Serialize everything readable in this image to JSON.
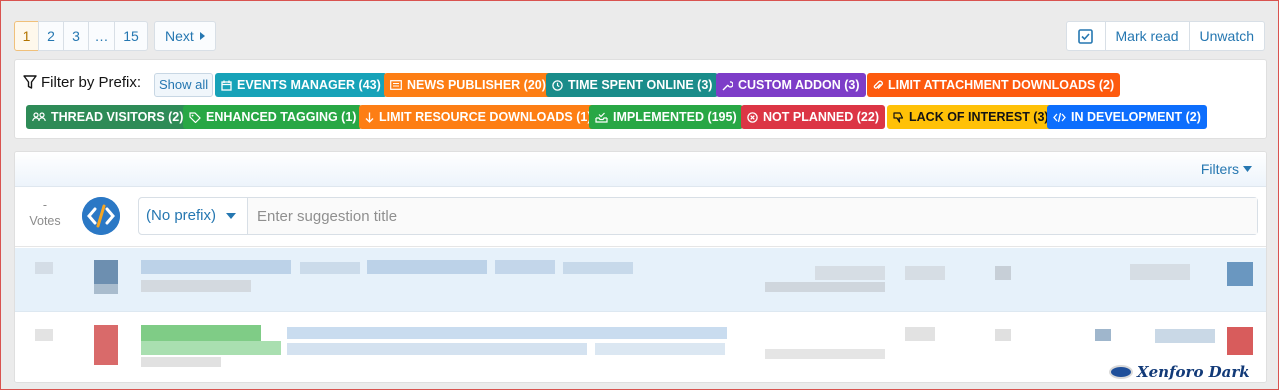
{
  "pagination": {
    "pages": [
      "1",
      "2",
      "3",
      "…",
      "15"
    ],
    "current": "1",
    "next_label": "Next"
  },
  "toolbar": {
    "mark_read": "Mark read",
    "unwatch": "Unwatch"
  },
  "filter": {
    "label": "Filter by Prefix:",
    "show_all": "Show all",
    "prefixes": [
      {
        "label": "EVENTS MANAGER (43)",
        "color": "#17a2b8",
        "icon": "calendar-icon"
      },
      {
        "label": "NEWS PUBLISHER (20)",
        "color": "#fd7e14",
        "icon": "newspaper-icon"
      },
      {
        "label": "TIME SPENT ONLINE (3)",
        "color": "#1a8c8a",
        "icon": "clock-icon"
      },
      {
        "label": "CUSTOM ADDON (3)",
        "color": "#7d3dc8",
        "icon": "wrench-icon"
      },
      {
        "label": "LIMIT ATTACHMENT DOWNLOADS (2)",
        "color": "#fd5a0e",
        "icon": "paperclip-icon"
      },
      {
        "label": "THREAD VISITORS (2)",
        "color": "#2e8b57",
        "icon": "users-icon"
      },
      {
        "label": "ENHANCED TAGGING (1)",
        "color": "#28a745",
        "icon": "tags-icon"
      },
      {
        "label": "LIMIT RESOURCE DOWNLOADS (1)",
        "color": "#fd7e14",
        "icon": "arrow-down-icon"
      },
      {
        "label": "IMPLEMENTED (195)",
        "color": "#28a745",
        "icon": "inbox-check-icon"
      },
      {
        "label": "NOT PLANNED (22)",
        "color": "#dc3545",
        "icon": "circle-x-icon"
      },
      {
        "label": "LACK OF INTEREST (3)",
        "color": "#ffc107",
        "icon": "thumbs-down-icon"
      },
      {
        "label": "IN DEVELOPMENT (2)",
        "color": "#0d6efd",
        "icon": "code-icon"
      }
    ]
  },
  "list": {
    "filters_label": "Filters",
    "new_suggestion": {
      "votes_value": "-",
      "votes_label": "Votes",
      "prefix_select": "(No prefix)",
      "title_placeholder": "Enter suggestion title"
    }
  },
  "watermark": "Xenforo Dark"
}
